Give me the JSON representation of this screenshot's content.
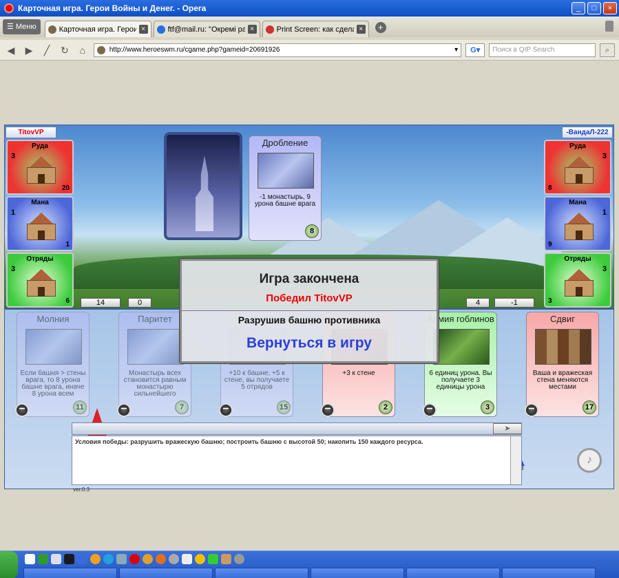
{
  "window": {
    "title": "Карточная игра. Герои Войны и Денег. - Opera"
  },
  "browser": {
    "menu_label": "Меню",
    "tabs": [
      {
        "label": "Карточная игра. Герои ...",
        "active": true
      },
      {
        "label": "ftf@mail.ru: \"Окремі рах...\"",
        "active": false
      },
      {
        "label": "Print Screen: как сделат...",
        "active": false
      }
    ],
    "url": "http://www.heroeswm.ru/cgame.php?gameid=20691926",
    "search_placeholder": "Поиск в QIP Search"
  },
  "game": {
    "left_player": {
      "name": "TitovVP",
      "ore": {
        "title": "Руда",
        "production": "3",
        "amount": "20"
      },
      "mana": {
        "title": "Мана",
        "production": "1",
        "amount": "1"
      },
      "troops": {
        "title": "Отряды",
        "production": "3",
        "amount": "6"
      },
      "tower": "14",
      "wall": "0"
    },
    "right_player": {
      "name": "-ВандаЛ-222",
      "ore": {
        "title": "Руда",
        "production": "3",
        "amount": "8"
      },
      "mana": {
        "title": "Мана",
        "production": "1",
        "amount": "9"
      },
      "troops": {
        "title": "Отряды",
        "production": "3",
        "amount": "3"
      },
      "tower": "-1",
      "wall": "4"
    },
    "played_card": {
      "title": "Дробление",
      "desc": "-1 монастырь, 9 урона башне врага",
      "cost": "8"
    },
    "hand": [
      {
        "title": "Молния",
        "desc": "Если башня > стены врага, то 8 урона башне врага, иначе 8 урона всем",
        "cost": "11",
        "faded": true
      },
      {
        "title": "Паритет",
        "desc": "Монастырь всех становится равным монастырю сильнейшего",
        "cost": "7",
        "faded": true
      },
      {
        "title": "",
        "desc": "+10 к башне, +5 к стене, вы получаете 5 отрядов",
        "cost": "15",
        "faded": true
      },
      {
        "title": "",
        "desc": "+3 к стене",
        "cost": "2",
        "faded": false
      },
      {
        "title": "Армия гоблинов",
        "desc": "6 единиц урона. Вы получаете 3 единицы урона",
        "cost": "3",
        "faded": false
      },
      {
        "title": "Сдвиг",
        "desc": "Ваша и вражеская стена меняются местами",
        "cost": "17",
        "faded": false
      }
    ],
    "log_text": "Условия победы: разрушить вражескую башню; построить башню с высотой 50; накопить 150 каждого ресурса.",
    "version": "ver.0.3"
  },
  "modal": {
    "heading": "Игра закончена",
    "winner": "Победил TitovVP",
    "reason": "Разрушив башню противника",
    "return_label": "Вернуться в игру"
  },
  "colors": {
    "ore": "#e33333",
    "mana": "#4d66d8",
    "troops": "#3dcb3d",
    "winner": "#ee0000",
    "link": "#2a3fd8"
  }
}
